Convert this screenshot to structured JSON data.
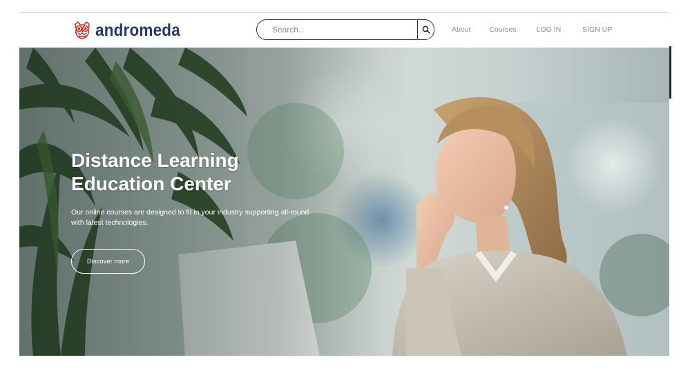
{
  "header": {
    "brand_name": "andromeda",
    "brand_logo_icon": "owl-icon",
    "brand_color": "#27396b",
    "logo_color": "#c0392b"
  },
  "search": {
    "placeholder": "Search..",
    "value": "",
    "button_icon": "search-icon"
  },
  "nav": {
    "about": "About",
    "courses": "Courses",
    "login": "LOG IN",
    "signup": "SIGN UP"
  },
  "hero": {
    "title_line1": "Distance Learning",
    "title_line2": "Education Center",
    "subtitle_line1": "Our online courses are designed to fit in your industry supporting all-round",
    "subtitle_line2": "with latest technologies.",
    "cta_label": "Discover more"
  }
}
